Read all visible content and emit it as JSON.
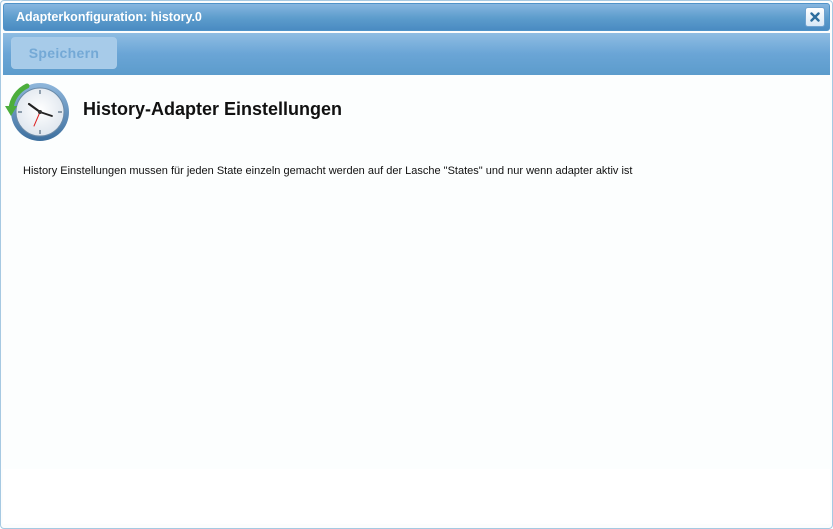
{
  "window": {
    "title": "Adapterkonfiguration: history.0",
    "close_icon": "close-icon"
  },
  "toolbar": {
    "save_label": "Speichern"
  },
  "main": {
    "icon": "clock-history-icon",
    "heading": "History-Adapter Einstellungen",
    "note": "History Einstellungen mussen für jeden State einzeln gemacht werden auf der Lasche \"States\" und nur wenn adapter aktiv ist"
  },
  "colors": {
    "titlebar": "#5c9ccc",
    "toolbar": "#6aa5d6",
    "button_text": "#74a9d6",
    "content_bg": "#fcfefe"
  }
}
